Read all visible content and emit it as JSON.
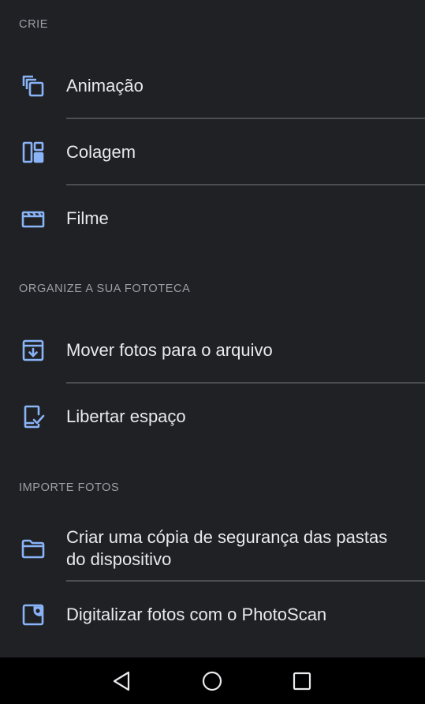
{
  "sections": [
    {
      "title": "CRIE",
      "items": [
        {
          "label": "Animação",
          "icon": "animation-icon"
        },
        {
          "label": "Colagem",
          "icon": "collage-icon"
        },
        {
          "label": "Filme",
          "icon": "movie-icon"
        }
      ]
    },
    {
      "title": "ORGANIZE A SUA FOTOTECA",
      "items": [
        {
          "label": "Mover fotos para o arquivo",
          "icon": "archive-icon"
        },
        {
          "label": "Libertar espaço",
          "icon": "free-up-space-icon"
        }
      ]
    },
    {
      "title": "IMPORTE FOTOS",
      "items": [
        {
          "label": "Criar uma cópia de segurança das pastas do dispositivo",
          "icon": "folder-icon"
        },
        {
          "label": "Digitalizar fotos com o PhotoScan",
          "icon": "photoscan-icon"
        }
      ]
    }
  ],
  "navbar": {
    "icons": [
      "back-icon",
      "home-icon",
      "recents-icon"
    ]
  },
  "colors": {
    "background": "#202124",
    "accent_icon": "#8ab4f8",
    "text": "#e8eaed",
    "section_header": "#9aa0a6",
    "navbar": "#000000"
  }
}
